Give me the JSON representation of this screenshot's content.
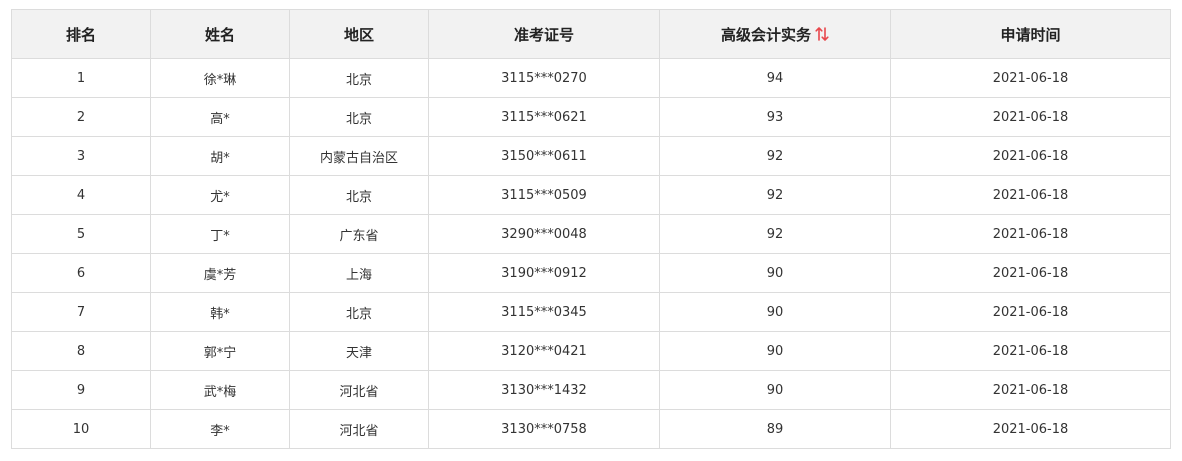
{
  "table": {
    "headers": {
      "rank": "排名",
      "name": "姓名",
      "region": "地区",
      "exam_id": "准考证号",
      "score": "高级会计实务",
      "date": "申请时间"
    },
    "sort_icon": "sort-arrows-icon",
    "sort_color": "#e8474c",
    "rows": [
      {
        "rank": "1",
        "name": "徐*琳",
        "region": "北京",
        "exam_id": "3115***0270",
        "score": "94",
        "date": "2021-06-18"
      },
      {
        "rank": "2",
        "name": "高*",
        "region": "北京",
        "exam_id": "3115***0621",
        "score": "93",
        "date": "2021-06-18"
      },
      {
        "rank": "3",
        "name": "胡*",
        "region": "内蒙古自治区",
        "exam_id": "3150***0611",
        "score": "92",
        "date": "2021-06-18"
      },
      {
        "rank": "4",
        "name": "尤*",
        "region": "北京",
        "exam_id": "3115***0509",
        "score": "92",
        "date": "2021-06-18"
      },
      {
        "rank": "5",
        "name": "丁*",
        "region": "广东省",
        "exam_id": "3290***0048",
        "score": "92",
        "date": "2021-06-18"
      },
      {
        "rank": "6",
        "name": "虞*芳",
        "region": "上海",
        "exam_id": "3190***0912",
        "score": "90",
        "date": "2021-06-18"
      },
      {
        "rank": "7",
        "name": "韩*",
        "region": "北京",
        "exam_id": "3115***0345",
        "score": "90",
        "date": "2021-06-18"
      },
      {
        "rank": "8",
        "name": "郭*宁",
        "region": "天津",
        "exam_id": "3120***0421",
        "score": "90",
        "date": "2021-06-18"
      },
      {
        "rank": "9",
        "name": "武*梅",
        "region": "河北省",
        "exam_id": "3130***1432",
        "score": "90",
        "date": "2021-06-18"
      },
      {
        "rank": "10",
        "name": "李*",
        "region": "河北省",
        "exam_id": "3130***0758",
        "score": "89",
        "date": "2021-06-18"
      }
    ]
  }
}
